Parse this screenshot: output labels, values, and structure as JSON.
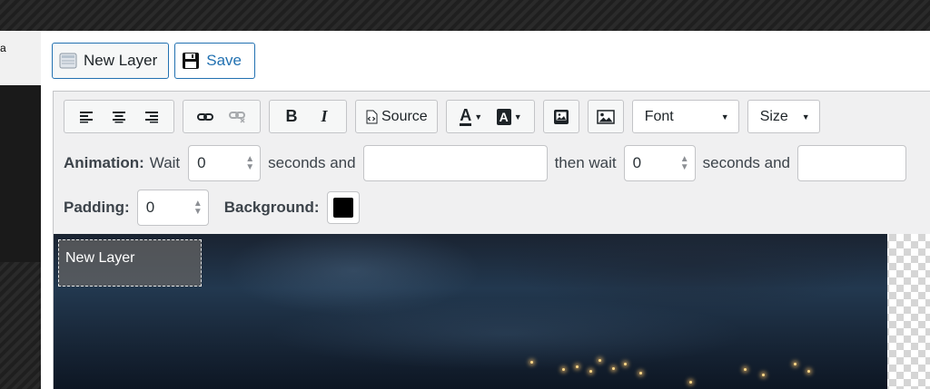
{
  "background": {
    "corner_text": "a"
  },
  "top_bar": {
    "new_layer_label": "New Layer",
    "save_label": "Save"
  },
  "toolbar": {
    "align_icons": [
      "align-left-icon",
      "align-center-icon",
      "align-right-icon"
    ],
    "link_icons": [
      "link-icon",
      "unlink-icon"
    ],
    "format_buttons": {
      "bold": "B",
      "italic": "I"
    },
    "source_label": "Source",
    "text_color_glyph": "A",
    "bg_color_glyph": "A",
    "font_select": "Font",
    "size_select": "Size"
  },
  "animation": {
    "label": "Animation:",
    "wait_label": "Wait",
    "wait_value": "0",
    "seconds_and_1": "seconds and",
    "effect_in_value": "",
    "then_wait_label": "then wait",
    "then_wait_value": "0",
    "seconds_and_2": "seconds and",
    "effect_out_value": ""
  },
  "padding": {
    "label": "Padding:",
    "value": "0"
  },
  "background_color": {
    "label": "Background:",
    "color": "#000000"
  },
  "canvas": {
    "layer_text": "New Layer"
  },
  "colors": {
    "accent": "#2271b1",
    "border": "#c3c4c7"
  }
}
